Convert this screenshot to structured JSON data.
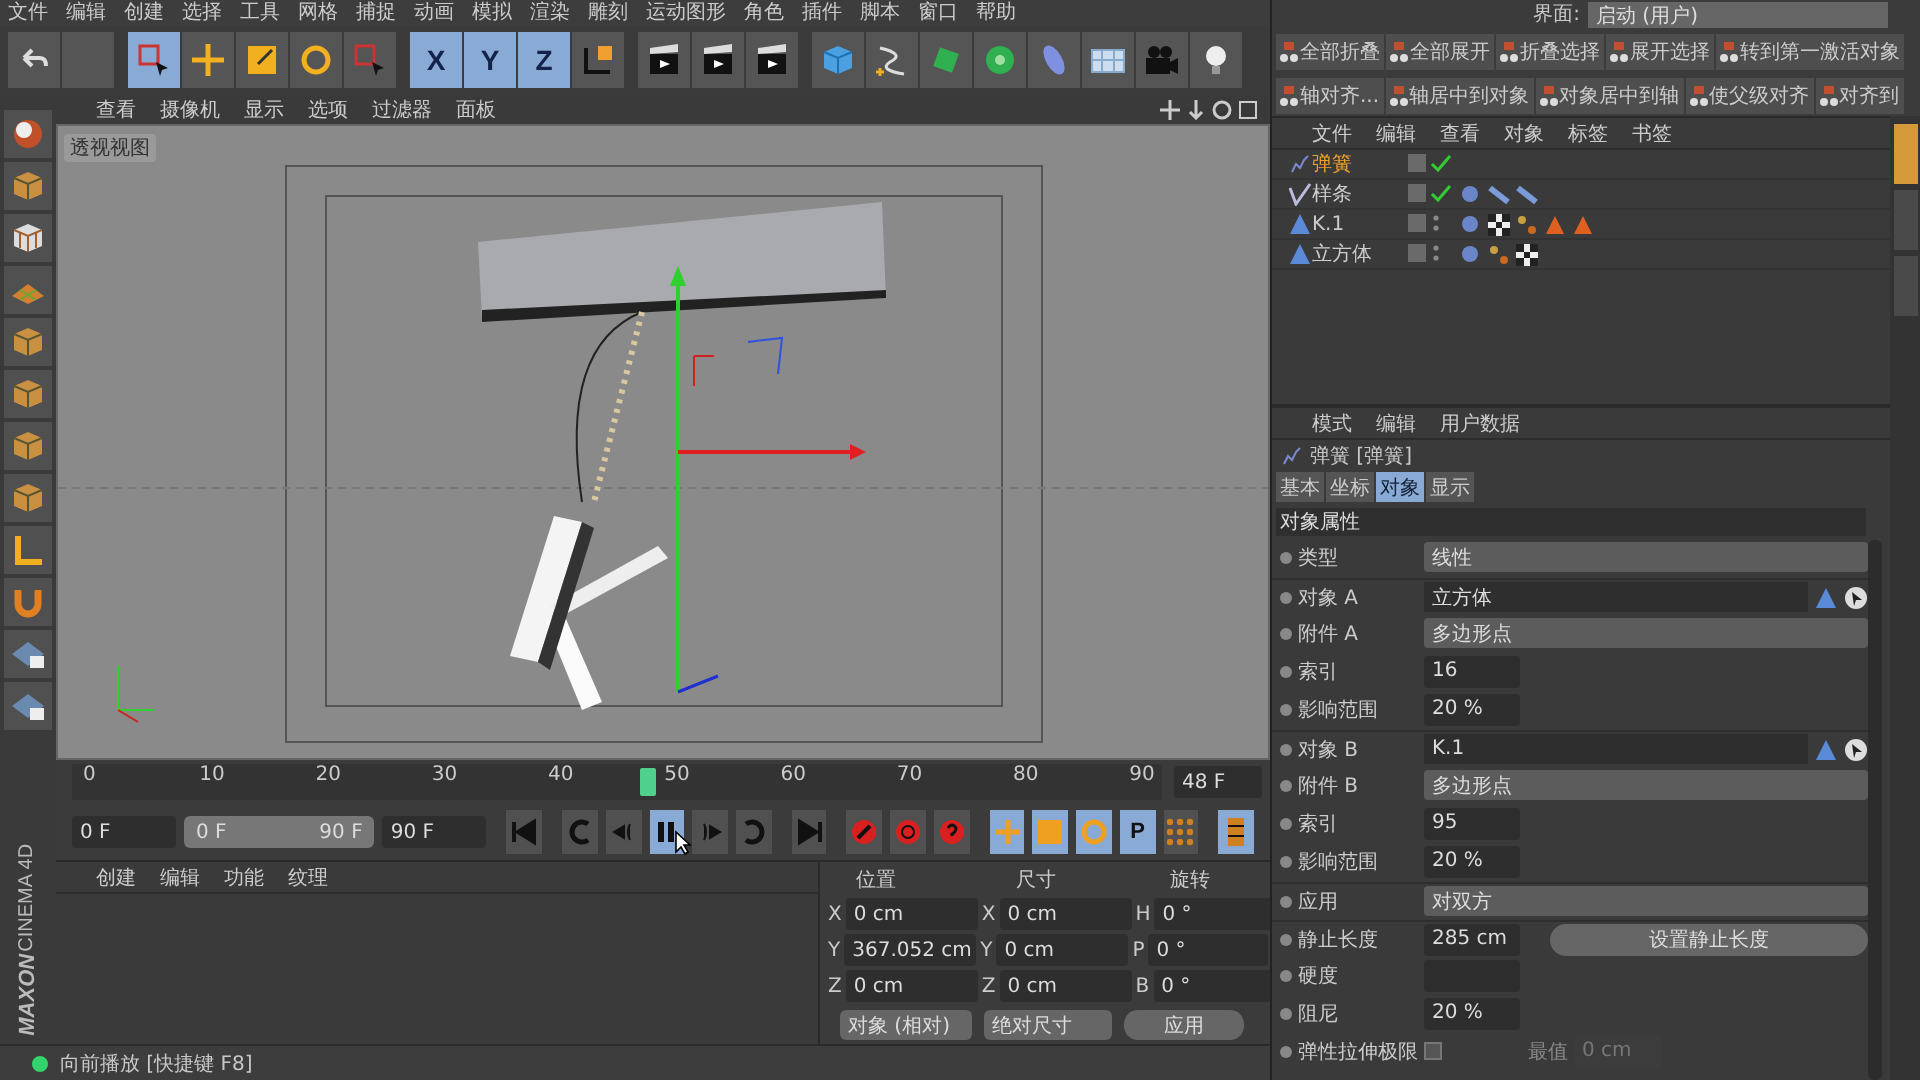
{
  "menu_bar": {
    "items": [
      "文件",
      "编辑",
      "创建",
      "选择",
      "工具",
      "网格",
      "捕捉",
      "动画",
      "模拟",
      "渲染",
      "雕刻",
      "运动图形",
      "角色",
      "插件",
      "脚本",
      "窗口",
      "帮助"
    ]
  },
  "toolbar": {
    "items": [
      {
        "kind": "undo",
        "selected": false
      },
      {
        "kind": "blank",
        "selected": false
      },
      {
        "kind": "select",
        "selected": true
      },
      {
        "kind": "move",
        "selected": false
      },
      {
        "kind": "scale",
        "selected": false
      },
      {
        "kind": "rotate",
        "selected": false
      },
      {
        "kind": "select",
        "selected": false
      },
      {
        "kind": "axis",
        "label": "X",
        "selected": true
      },
      {
        "kind": "axis",
        "label": "Y",
        "selected": true
      },
      {
        "kind": "axis",
        "label": "Z",
        "selected": true
      },
      {
        "kind": "coords",
        "selected": false
      },
      {
        "kind": "render",
        "selected": false
      },
      {
        "kind": "render",
        "selected": false
      },
      {
        "kind": "render",
        "selected": false
      },
      {
        "kind": "cube",
        "selected": false
      },
      {
        "kind": "spline",
        "selected": false
      },
      {
        "kind": "generator",
        "selected": false
      },
      {
        "kind": "cloner",
        "selected": false
      },
      {
        "kind": "deformer",
        "selected": false
      },
      {
        "kind": "floor",
        "selected": false
      },
      {
        "kind": "camera",
        "selected": false
      },
      {
        "kind": "light",
        "selected": false
      }
    ]
  },
  "viewport": {
    "menu": [
      "查看",
      "摄像机",
      "显示",
      "选项",
      "过滤器",
      "面板"
    ],
    "label": "透视视图"
  },
  "timeline": {
    "ticks": [
      "0",
      "10",
      "20",
      "30",
      "40",
      "50",
      "60",
      "70",
      "80",
      "90"
    ],
    "level": 0.533,
    "current": "48 F"
  },
  "transport": {
    "start": "0 F",
    "range": {
      "start": "0 F",
      "end": "90 F",
      "level": 1
    },
    "end": "90 F",
    "buttons": [
      {
        "kind": "first",
        "selected": false
      },
      {
        "kind": "prev-key",
        "selected": false
      },
      {
        "kind": "prev-frame",
        "selected": false
      },
      {
        "kind": "pause",
        "selected": true
      },
      {
        "kind": "next-frame",
        "selected": false
      },
      {
        "kind": "next-key",
        "selected": false
      },
      {
        "kind": "last",
        "selected": false
      },
      {
        "kind": "record",
        "selected": false
      },
      {
        "kind": "auto-key",
        "selected": false
      },
      {
        "kind": "help",
        "selected": false
      },
      {
        "kind": "move",
        "selected": true
      },
      {
        "kind": "scale",
        "selected": true
      },
      {
        "kind": "rotate",
        "selected": true
      },
      {
        "kind": "param",
        "label": "P",
        "selected": true
      },
      {
        "kind": "points",
        "selected": false
      },
      {
        "kind": "film",
        "selected": true
      }
    ]
  },
  "material_manager": {
    "menu": [
      "创建",
      "编辑",
      "功能",
      "纹理"
    ]
  },
  "coordinates": {
    "headers": [
      "位置",
      "尺寸",
      "旋转"
    ],
    "rows": [
      [
        {
          "axis": "X",
          "value": "0 cm"
        },
        {
          "axis": "X",
          "value": "0 cm"
        },
        {
          "axis": "H",
          "value": "0 °"
        }
      ],
      [
        {
          "axis": "Y",
          "value": "367.052 cm"
        },
        {
          "axis": "Y",
          "value": "0 cm"
        },
        {
          "axis": "P",
          "value": "0 °"
        }
      ],
      [
        {
          "axis": "Z",
          "value": "0 cm"
        },
        {
          "axis": "Z",
          "value": "0 cm"
        },
        {
          "axis": "B",
          "value": "0 °"
        }
      ]
    ],
    "mode": "对象 (相对)",
    "size_mode": "绝对尺寸",
    "apply": "应用"
  },
  "status_bar": {
    "text": "向前播放 [快捷键 F8]"
  },
  "brand": {
    "company": "MAXON",
    "product": "CINEMA 4D"
  },
  "layout_selector": {
    "label": "界面:",
    "value": "启动 (用户)"
  },
  "command_rows": [
    [
      "全部折叠",
      "全部展开",
      "折叠选择",
      "展开选择",
      "转到第一激活对象"
    ],
    [
      "轴对齐...",
      "轴居中到对象",
      "对象居中到轴",
      "使父级对齐",
      "对齐到"
    ]
  ],
  "object_manager": {
    "menu": [
      "文件",
      "编辑",
      "查看",
      "对象",
      "标签",
      "书签"
    ],
    "rows": [
      {
        "name": "弹簧",
        "selected": true,
        "checked": true
      },
      {
        "name": "样条",
        "selected": false,
        "checked": true,
        "tags": [
          {
            "kind": "sphere"
          },
          {
            "kind": "bones"
          },
          {
            "kind": "bones"
          }
        ]
      },
      {
        "name": "K.1",
        "selected": false,
        "checked": false,
        "tags": [
          {
            "kind": "sphere"
          },
          {
            "kind": "checker"
          },
          {
            "kind": "dots"
          },
          {
            "kind": "triangle"
          },
          {
            "kind": "triangle"
          }
        ]
      },
      {
        "name": "立方体",
        "selected": false,
        "checked": false,
        "tags": [
          {
            "kind": "sphere"
          },
          {
            "kind": "dots"
          },
          {
            "kind": "checker"
          }
        ]
      }
    ]
  },
  "attribute_manager": {
    "menu": [
      "模式",
      "编辑",
      "用户数据"
    ],
    "title": "弹簧 [弹簧]",
    "tabs": [
      {
        "label": "基本",
        "selected": false
      },
      {
        "label": "坐标",
        "selected": false
      },
      {
        "label": "对象",
        "selected": true
      },
      {
        "label": "显示",
        "selected": false
      }
    ],
    "section": "对象属性",
    "fields": [
      {
        "kind": "dropdown",
        "label": "类型",
        "value": "线性"
      },
      {
        "kind": "link",
        "label": "对象 A",
        "value": "立方体"
      },
      {
        "kind": "dropdown",
        "label": "附件 A",
        "value": "多边形点"
      },
      {
        "kind": "number",
        "label": "索引",
        "value": "16"
      },
      {
        "kind": "number",
        "label": "影响范围",
        "value": "20 %"
      },
      {
        "kind": "link",
        "label": "对象 B",
        "value": "K.1"
      },
      {
        "kind": "dropdown",
        "label": "附件 B",
        "value": "多边形点"
      },
      {
        "kind": "number",
        "label": "索引",
        "value": "95"
      },
      {
        "kind": "number",
        "label": "影响范围",
        "value": "20 %"
      },
      {
        "kind": "dropdown",
        "label": "应用",
        "value": "对双方"
      },
      {
        "kind": "number_button",
        "label": "静止长度",
        "value": "285 cm",
        "button": "设置静止长度"
      },
      {
        "kind": "number",
        "label": "硬度"
      },
      {
        "kind": "number",
        "label": "阻尼",
        "value": "20 %"
      },
      {
        "kind": "checkbox",
        "label": "弹性拉伸极限",
        "checked": false,
        "extra_label": "最值",
        "extra_value": "0 cm"
      }
    ]
  },
  "side_tabs": [
    {
      "selected": true
    },
    {
      "selected": false
    },
    {
      "selected": false
    }
  ]
}
